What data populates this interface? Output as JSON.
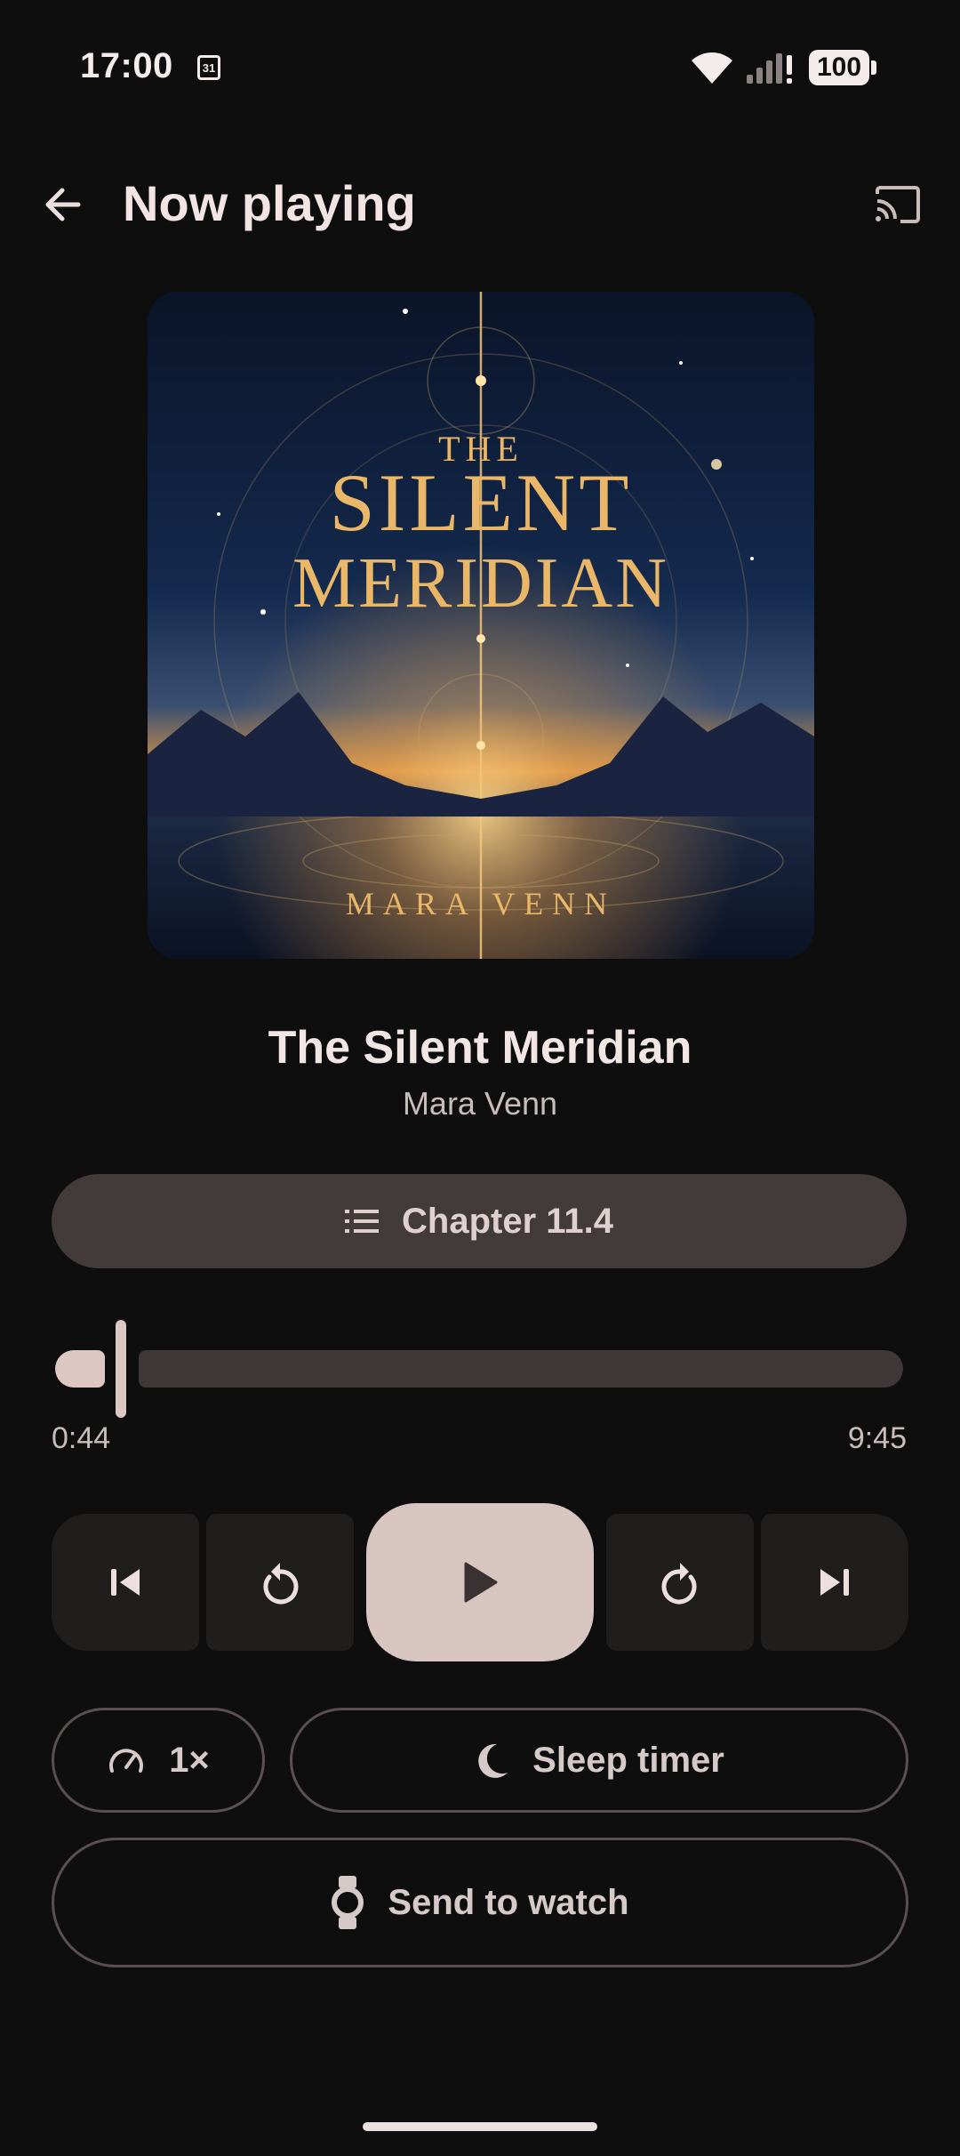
{
  "status_bar": {
    "time": "17:00",
    "calendar_day": "31",
    "battery_level": "100"
  },
  "header": {
    "title": "Now playing",
    "back_icon": "arrow-left-icon",
    "cast_icon": "cast-icon"
  },
  "cover": {
    "title_line1": "THE",
    "title_line2": "SILENT",
    "title_line3": "MERIDIAN",
    "author": "MARA VENN"
  },
  "book": {
    "title": "The Silent Meridian",
    "author": "Mara Venn"
  },
  "chapter": {
    "label": "Chapter 11.4",
    "icon": "list-icon"
  },
  "progress": {
    "current": "0:44",
    "total": "9:45",
    "fraction": 0.075
  },
  "transport": {
    "prev_icon": "skip-previous-icon",
    "rewind_icon": "replay-icon",
    "play_icon": "play-icon",
    "forward_icon": "forward-icon",
    "next_icon": "skip-next-icon"
  },
  "controls": {
    "speed_label": "1×",
    "sleep_label": "Sleep timer",
    "watch_label": "Send to watch"
  },
  "colors": {
    "background": "#0f0e0e",
    "accent": "#d8c4c0",
    "pill": "#433a3a",
    "cover_gold": "#e9b767"
  }
}
